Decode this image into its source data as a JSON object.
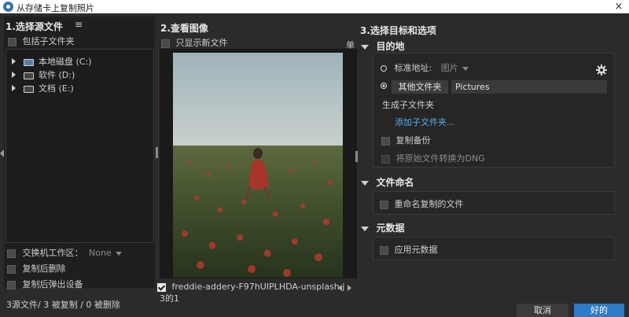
{
  "window": {
    "title": "从存储卡上复制照片",
    "close_glyph": "×"
  },
  "source": {
    "header": "1.选择源文件",
    "menu_glyph": "≡",
    "include_subfolders": "包括子文件夹",
    "drives": [
      {
        "label": "本地磁盘 (C:)"
      },
      {
        "label": "软件 (D:)"
      },
      {
        "label": "文档 (E:)"
      }
    ],
    "exchange_label": "交换机工作区：",
    "exchange_value": "None",
    "delete_after_copy": "复制后删除",
    "eject_after_copy": "复制后弹出设备"
  },
  "review": {
    "header": "2.查看图像",
    "show_new_only": "只显示新文件",
    "mode_label": "单",
    "filename": "freddie-addery-F97hUIPLHDA-unsplash.j",
    "counter": "3的1"
  },
  "options": {
    "header": "3.选择目标和选项",
    "destination": {
      "title": "目的地",
      "standard_location": "标准地址:",
      "standard_value": "图片",
      "other_folder_button": "其他文件夹",
      "other_folder_path": "Pictures",
      "create_subfolder": "生成子文件夹",
      "add_subfolder_link": "添加子文件夹...",
      "make_backup": "复制备份",
      "convert_dng": "将原始文件转换为DNG"
    },
    "file_naming": {
      "title": "文件命名",
      "rename_copies": "重命名复制的文件"
    },
    "metadata": {
      "title": "元数据",
      "apply_metadata": "应用元数据"
    }
  },
  "footer": {
    "status": "3源文件/ 3 被复制 / 0 被删除",
    "cancel": "取消",
    "ok": "好的"
  },
  "colors": {
    "accent": "#2f7bc9",
    "link": "#5aa9e6"
  }
}
